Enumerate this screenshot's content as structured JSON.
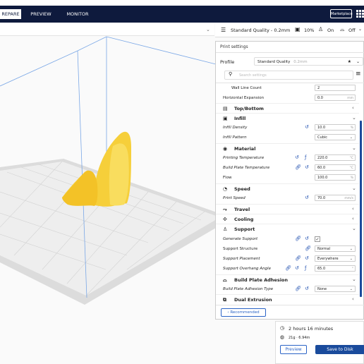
{
  "header": {
    "tabs": [
      {
        "label": "REPARE"
      },
      {
        "label": "PREVIEW"
      },
      {
        "label": "MONITOR"
      }
    ],
    "marketplace_label": "Marketplace"
  },
  "quality_bar": {
    "profile_label": "Standard Quality - 0.2mm",
    "infill_label": "10%",
    "support_label": "On",
    "adhesion_label": "Off"
  },
  "print_settings": {
    "title": "Print settings",
    "profile_label": "Profile",
    "profile_value": "Standard Quality",
    "profile_suffix": "0.2mm",
    "search_placeholder": "Search settings",
    "wall_line_count": {
      "label": "Wall Line Count",
      "value": "2"
    },
    "horizontal_expansion": {
      "label": "Horizontal Expansion",
      "value": "0.0",
      "unit": "mm"
    },
    "categories": {
      "top_bottom": "Top/Bottom",
      "infill": "Infill",
      "material": "Material",
      "speed": "Speed",
      "travel": "Travel",
      "cooling": "Cooling",
      "support": "Support",
      "adhesion": "Build Plate Adhesion",
      "dual": "Dual Extrusion"
    },
    "infill_density": {
      "label": "Infill Density",
      "value": "10.0",
      "unit": "%"
    },
    "infill_pattern": {
      "label": "Infill Pattern",
      "value": "Cubic"
    },
    "printing_temp": {
      "label": "Printing Temperature",
      "value": "220.0",
      "unit": "°C"
    },
    "build_plate_temp": {
      "label": "Build Plate Temperature",
      "value": "60.0",
      "unit": "°C"
    },
    "flow": {
      "label": "Flow",
      "value": "100.0",
      "unit": "%"
    },
    "print_speed": {
      "label": "Print Speed",
      "value": "70.0",
      "unit": "mm/s"
    },
    "generate_support": {
      "label": "Generate Support",
      "checked": true
    },
    "support_structure": {
      "label": "Support Structure",
      "value": "Normal"
    },
    "support_placement": {
      "label": "Support Placement",
      "value": "Everywhere"
    },
    "support_overhang": {
      "label": "Support Overhang Angle",
      "value": "65.0",
      "unit": "°"
    },
    "adhesion_type": {
      "label": "Build Plate Adhesion Type",
      "value": "None"
    },
    "recommended_label": "Recommended"
  },
  "summary": {
    "time": "2 hours 16 minutes",
    "material": "21g · 6.94m",
    "preview_label": "Preview",
    "save_label": "Save to Disk"
  },
  "colors": {
    "header": "#0e1a3d",
    "accent": "#2a63c6",
    "model": "#f8d03a"
  }
}
